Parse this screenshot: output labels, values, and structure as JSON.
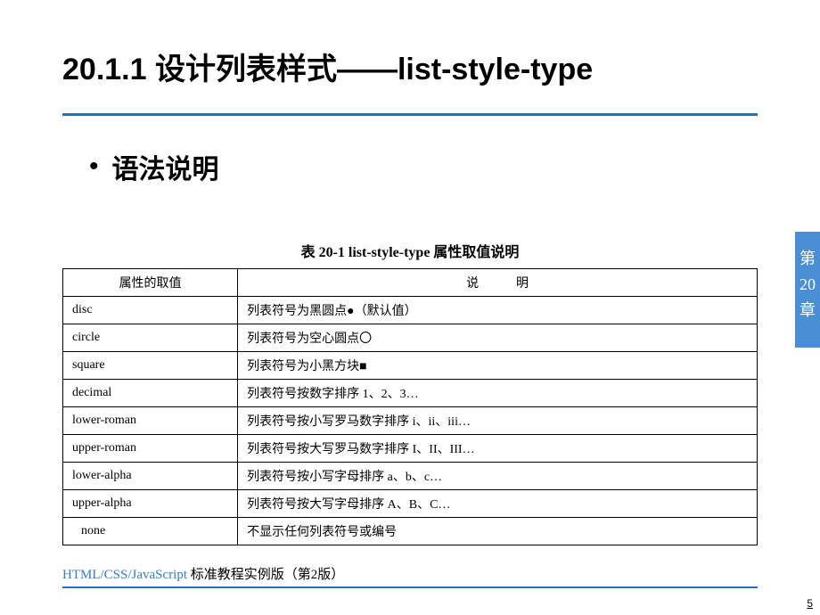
{
  "title": "20.1.1  设计列表样式——list-style-type",
  "bullet": "语法说明",
  "tableCaption": "表 20-1    list-style-type 属性取值说明",
  "headers": {
    "col1": "属性的取值",
    "col2": "说　明"
  },
  "rows": [
    {
      "value": "disc",
      "desc": "列表符号为黑圆点●（默认值）"
    },
    {
      "value": "circle",
      "desc": "列表符号为空心圆点〇"
    },
    {
      "value": "square",
      "desc": "列表符号为小黑方块■"
    },
    {
      "value": "decimal",
      "desc": "列表符号按数字排序 1、2、3…"
    },
    {
      "value": "lower-roman",
      "desc": "列表符号按小写罗马数字排序 i、ii、iii…"
    },
    {
      "value": "upper-roman",
      "desc": "列表符号按大写罗马数字排序 I、II、III…"
    },
    {
      "value": "lower-alpha",
      "desc": "列表符号按小写字母排序 a、b、c…"
    },
    {
      "value": "upper-alpha",
      "desc": "列表符号按大写字母排序 A、B、C…"
    },
    {
      "value": "none",
      "desc": "不显示任何列表符号或编号",
      "indent": true
    }
  ],
  "chapterTab": {
    "line1": "第",
    "line2": "20",
    "line3": "章"
  },
  "footer": {
    "tech": "HTML/CSS/JavaScript",
    "rest": "  标准教程实例版（第2版）"
  },
  "pageNum": "5"
}
